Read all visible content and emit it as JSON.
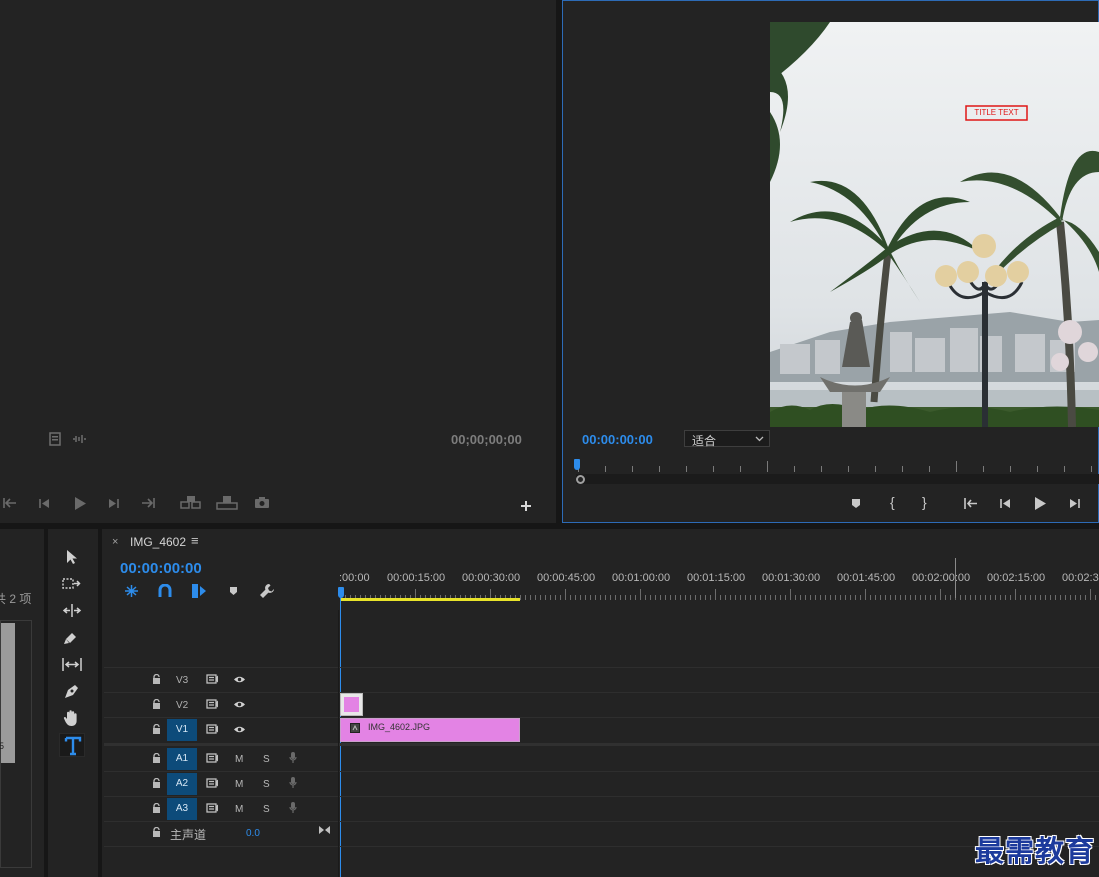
{
  "source_monitor": {
    "timecode": "00;00;00;00"
  },
  "program_monitor": {
    "timecode": "00:00:00:00",
    "fit_label": "适合",
    "fit_arrow": "chevron-down-icon",
    "overlay_text": "TITLE TEXT"
  },
  "project": {
    "item_count_label": "共 2 项",
    "thumb_text": "5"
  },
  "timeline": {
    "tab_close": "×",
    "tab_title": "IMG_4602",
    "tab_menu": "≡",
    "timecode": "00:00:00:00",
    "ruler": [
      ":00:00",
      "00:00:15:00",
      "00:00:30:00",
      "00:00:45:00",
      "00:01:00:00",
      "00:01:15:00",
      "00:01:30:00",
      "00:01:45:00",
      "00:02:00:00",
      "00:02:15:00",
      "00:02:3"
    ],
    "tracks": {
      "v3": "V3",
      "v2": "V2",
      "v1": "V1",
      "a1": "A1",
      "a2": "A2",
      "a3": "A3",
      "m": "M",
      "s": "S"
    },
    "master": {
      "label": "主声道",
      "value": "0.0"
    },
    "clip": {
      "name": "IMG_4602.JPG",
      "color": "#e383e4"
    }
  },
  "watermark": "最需教育",
  "colors": {
    "accent": "#2d8ceb",
    "track_blue": "#0d4b7a",
    "clip_pink": "#e383e4",
    "work_area": "#e8e32a"
  }
}
